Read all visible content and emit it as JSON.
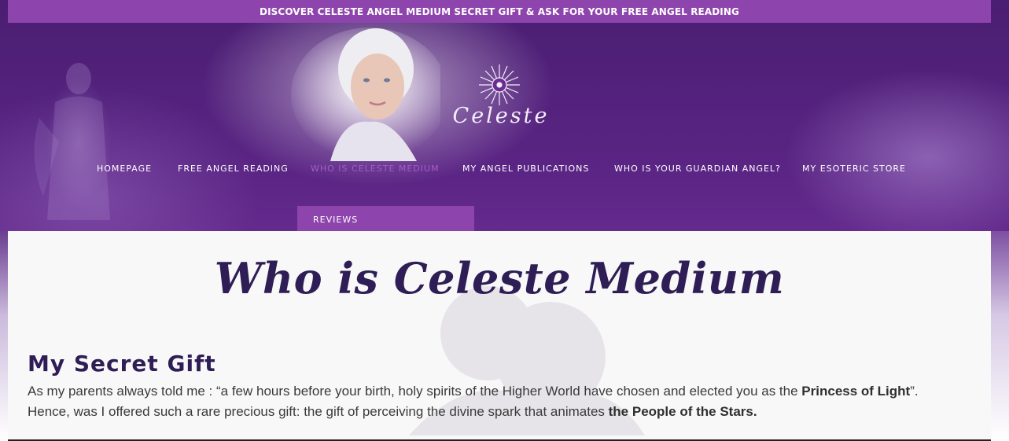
{
  "banner": {
    "text": "DISCOVER CELESTE ANGEL MEDIUM SECRET GIFT & ASK FOR YOUR FREE ANGEL READING"
  },
  "logo": {
    "text": "Celeste",
    "icon": "star-burst-icon"
  },
  "nav": {
    "items": [
      {
        "label": "HOMEPAGE"
      },
      {
        "label": "FREE ANGEL READING"
      },
      {
        "label": "WHO IS CELESTE MEDIUM"
      },
      {
        "label": "MY ANGEL PUBLICATIONS"
      },
      {
        "label": "WHO IS YOUR GUARDIAN ANGEL?"
      },
      {
        "label": "MY ESOTERIC STORE"
      }
    ],
    "active_index": 2,
    "dropdown": {
      "label": "REVIEWS"
    }
  },
  "main": {
    "title": "Who is Celeste Medium",
    "section_title": "My Secret Gift",
    "paragraph1": {
      "text": "As my parents always told me : “a few hours before your birth, holy spirits of the Higher World have chosen and elected you as the ",
      "bold": "Princess of Light",
      "end": "”."
    },
    "paragraph2": {
      "text": "Hence, was I offered such a rare precious gift: the gift of perceiving the divine spark that animates ",
      "bold": "the People of the Stars."
    }
  },
  "colors": {
    "accent": "#8e44ad",
    "heading": "#2f1d55",
    "active_nav": "#a45cc9",
    "content_bg": "#f8f8f9"
  }
}
